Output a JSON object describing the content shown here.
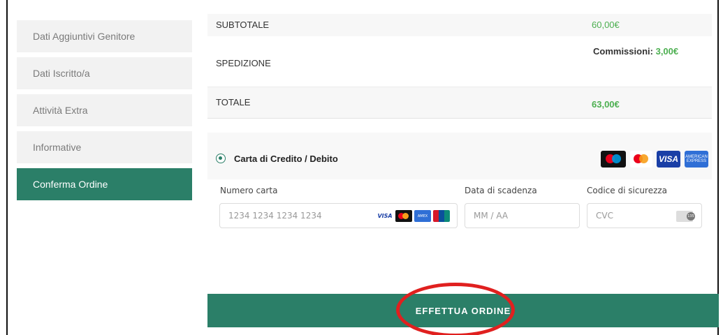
{
  "sidebar": {
    "items": [
      {
        "label": "Dati Aggiuntivi Genitore",
        "active": false
      },
      {
        "label": "Dati Iscritto/a",
        "active": false
      },
      {
        "label": "Attività Extra",
        "active": false
      },
      {
        "label": "Informative",
        "active": false
      },
      {
        "label": "Conferma Ordine",
        "active": true
      }
    ]
  },
  "totals": {
    "subtotal_label": "SUBTOTALE",
    "subtotal_value": "60,00€",
    "shipping_label": "SPEDIZIONE",
    "commission_label": "Commissioni:",
    "commission_value": "3,00€",
    "total_label": "TOTALE",
    "total_value": "63,00€"
  },
  "payment": {
    "method_label": "Carta di Credito / Debito",
    "header_logos": [
      "maestro-icon",
      "mastercard-icon",
      "visa-icon",
      "amex-icon"
    ],
    "card_number_label": "Numero carta",
    "card_number_placeholder": "1234 1234 1234 1234",
    "card_logos": [
      "visa",
      "mastercard",
      "amex",
      "unionpay"
    ],
    "expiry_label": "Data di scadenza",
    "expiry_placeholder": "MM / AA",
    "cvc_label": "Codice di sicurezza",
    "cvc_placeholder": "CVC"
  },
  "order_button": {
    "label": "EFFETTUA ORDINE"
  },
  "colors": {
    "primary": "#2b7f68",
    "price_green": "#4caf50",
    "annotation_red": "#e0201f"
  }
}
